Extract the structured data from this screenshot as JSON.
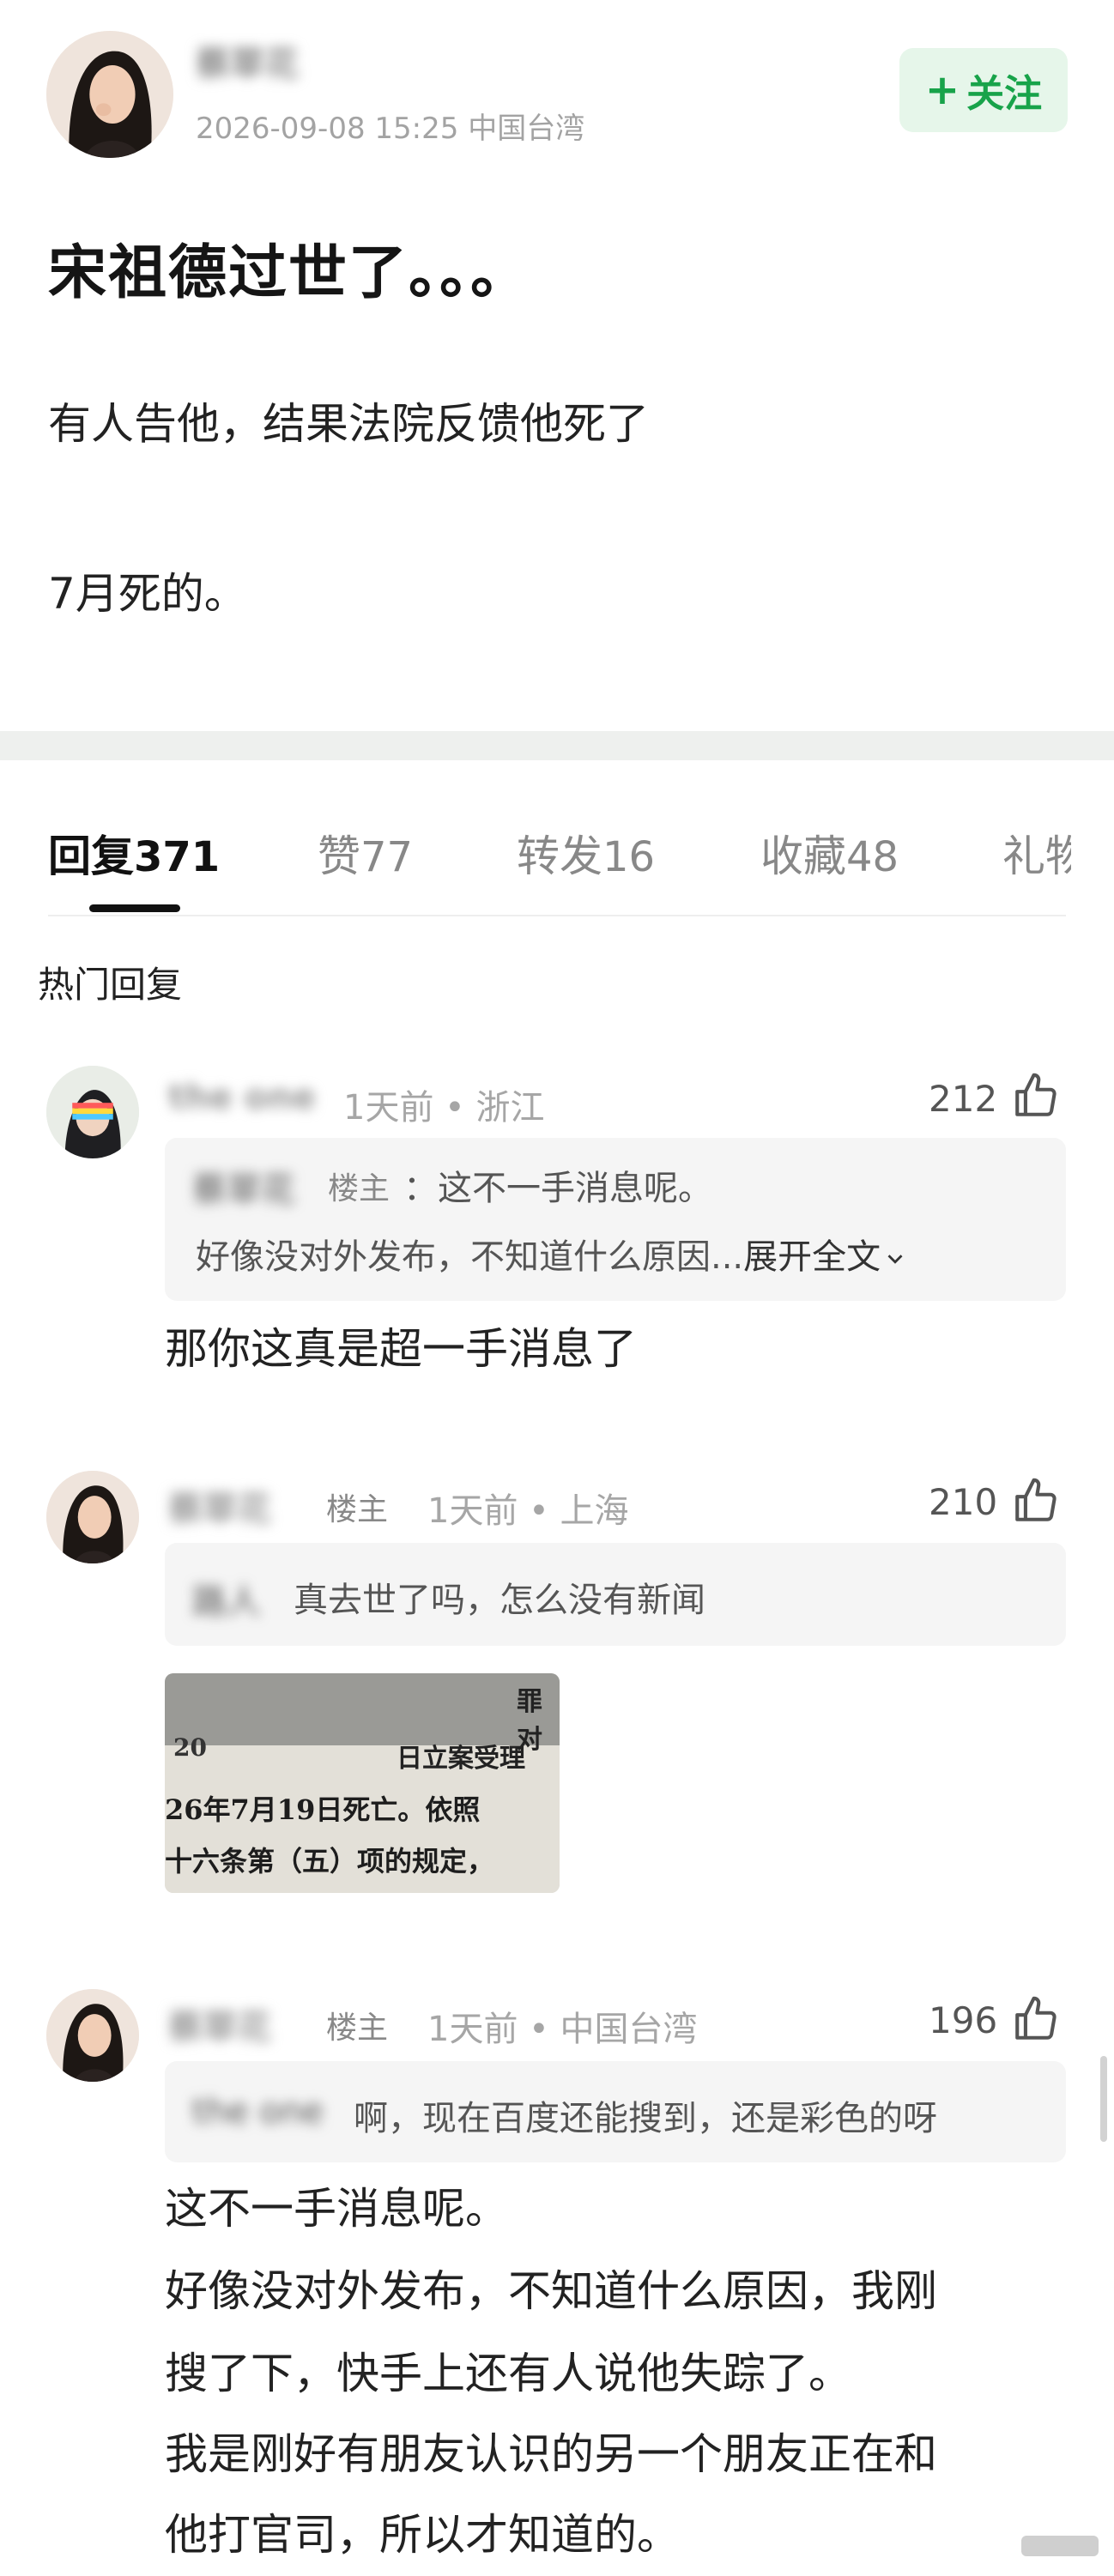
{
  "post": {
    "author_name": "蔡翠花",
    "meta": "2026-09-08 15:25  中国台湾",
    "follow_plus": "+",
    "follow_label": "关注",
    "title": "宋祖德过世了。。。",
    "body_lines": [
      "有人告他，结果法院反馈他死了",
      "7月死的。"
    ]
  },
  "tabs": [
    {
      "label": "回复",
      "count": "371"
    },
    {
      "label": "赞",
      "count": "77"
    },
    {
      "label": "转发",
      "count": "16"
    },
    {
      "label": "收藏",
      "count": "48"
    },
    {
      "label": "礼物",
      "count": ""
    }
  ],
  "section_title": "热门回复",
  "comments": [
    {
      "name": "the one",
      "owner_tag": "",
      "time": "1天前",
      "location": "浙江",
      "likes": "212",
      "quote_name": "蔡翠花",
      "quote_owner_tag": "楼主",
      "quote_line1": "：这不一手消息呢。",
      "quote_line2": "好像没对外发布，不知道什么原因...",
      "expand_label": "展开全文",
      "text": "那你这真是超一手消息了"
    },
    {
      "name": "蔡翠花",
      "owner_tag": "楼主",
      "time": "1天前",
      "location": "上海",
      "likes": "210",
      "quote_name": "路人",
      "quote_text": "真去世了吗，怎么没有新闻",
      "image_lines": [
        "罪对",
        "20",
        "日立案受理",
        "26年7月19日死亡。依照",
        "十六条第（五）项的规定，"
      ]
    },
    {
      "name": "蔡翠花",
      "owner_tag": "楼主",
      "time": "1天前",
      "location": "中国台湾",
      "likes": "196",
      "quote_name": "the one",
      "quote_text": "啊，现在百度还能搜到，还是彩色的呀",
      "text_lines": [
        "这不一手消息呢。",
        "好像没对外发布，不知道什么原因，我刚",
        "搜了下，快手上还有人说他失踪了。",
        "我是刚好有朋友认识的另一个朋友正在和",
        "他打官司，所以才知道的。"
      ]
    }
  ],
  "colors": {
    "accent_green": "#18a34a",
    "follow_bg": "#e6f6ea",
    "quote_bg": "#f5f5f5"
  },
  "icons": {
    "like": "thumbs-up-icon",
    "expand": "chevron-down-icon"
  }
}
